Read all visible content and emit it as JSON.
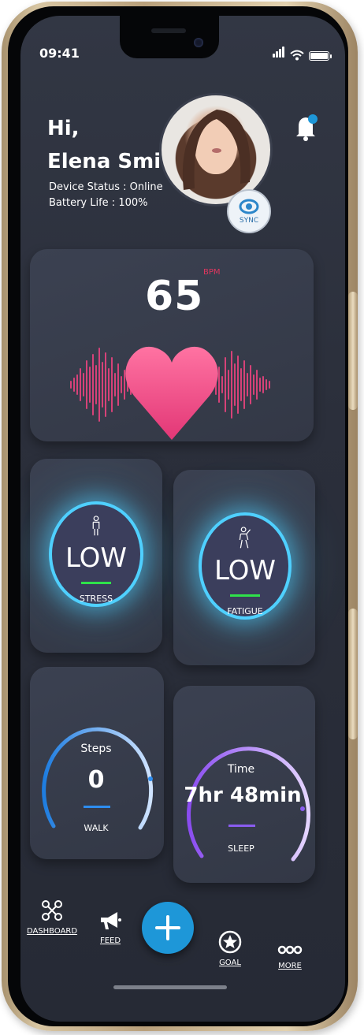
{
  "status_bar": {
    "time": "09:41"
  },
  "header": {
    "greeting_line1": "Hi,",
    "greeting_line2": "Elena Smith",
    "device_status": "Device Status : Online",
    "battery_life": "Battery Life : 100%",
    "sync_label": "SYNC",
    "notification_icon": "bell-icon"
  },
  "heart_rate": {
    "value": "65",
    "unit": "BPM"
  },
  "stress": {
    "level": "LOW",
    "label": "STRESS"
  },
  "fatigue": {
    "level": "LOW",
    "label": "FATIGUE"
  },
  "steps": {
    "title": "Steps",
    "value": "0",
    "label": "WALK"
  },
  "sleep": {
    "title": "Time",
    "value": "7hr 48min",
    "label": "SLEEP"
  },
  "nav": {
    "dashboard": "DASHBOARD",
    "feed": "FEED",
    "goal": "GOAL",
    "more": "MORE"
  },
  "colors": {
    "accent": "#1e97d8",
    "heart": "#e8437e",
    "glow": "#4fd0ff",
    "ok": "#2fe24a",
    "sleep": "#8a5cf0"
  }
}
